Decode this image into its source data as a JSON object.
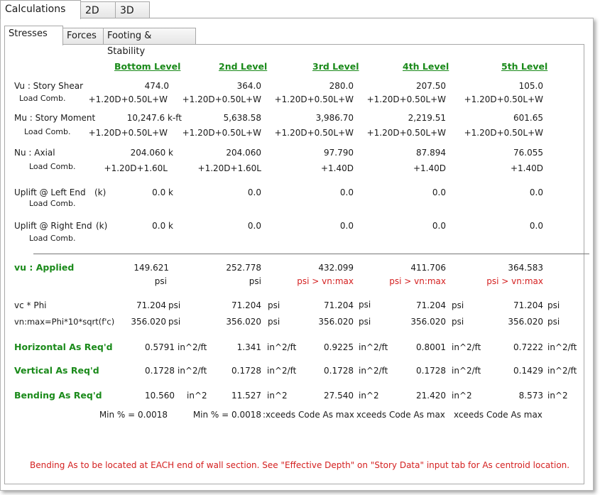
{
  "top_tabs": [
    "Calculations",
    "2D",
    "3D"
  ],
  "sub_tabs": [
    "Stresses",
    "Forces",
    "Footing & Stability"
  ],
  "levels": [
    "Bottom Level",
    "2nd Level",
    "3rd Level",
    "4th Level",
    "5th Level"
  ],
  "labels": {
    "vu_story_shear": "Vu : Story Shear",
    "mu_story_moment": "Mu : Story Moment",
    "nu_axial": "Nu : Axial",
    "uplift_left": "Uplift @ Left End",
    "uplift_right": "Uplift @ Right End",
    "k_unit": "(k)",
    "load_comb": "Load Comb.",
    "vu_applied": "vu : Applied",
    "vc_phi": "vc * Phi",
    "vnmax": "vn:max=Phi*10*sqrt(f'c)",
    "horizontal_as": "Horizontal As Req'd",
    "vertical_as": "Vertical As Req'd",
    "bending_as": "Bending As Req'd"
  },
  "vu_values": [
    "474.0",
    "364.0",
    "280.0",
    "207.50",
    "105.0"
  ],
  "vu_comb": [
    "+1.20D+0.50L+W",
    "+1.20D+0.50L+W",
    "+1.20D+0.50L+W",
    "+1.20D+0.50L+W",
    "+1.20D+0.50L+W"
  ],
  "mu_values": [
    "10,247.6 k-ft",
    "5,638.58",
    "3,986.70",
    "2,219.51",
    "601.65"
  ],
  "mu_comb": [
    "+1.20D+0.50L+W",
    "+1.20D+0.50L+W",
    "+1.20D+0.50L+W",
    "+1.20D+0.50L+W",
    "+1.20D+0.50L+W"
  ],
  "nu_values": [
    "204.060 k",
    "204.060",
    "97.790",
    "87.894",
    "76.055"
  ],
  "nu_comb": [
    "+1.20D+1.60L",
    "+1.20D+1.60L",
    "+1.40D",
    "+1.40D",
    "+1.40D"
  ],
  "uplift_left_values": [
    "0.0 k",
    "0.0",
    "0.0",
    "0.0",
    "0.0"
  ],
  "uplift_right_values": [
    "0.0 k",
    "0.0",
    "0.0",
    "0.0",
    "0.0"
  ],
  "vu_applied_values": [
    "149.621",
    "252.778",
    "432.099",
    "411.706",
    "364.583"
  ],
  "vu_applied_units": [
    "psi",
    "psi",
    "psi > vn:max",
    "psi > vn:max",
    "psi > vn:max"
  ],
  "vc_phi_values": [
    "71.204",
    "71.204",
    "71.204",
    "71.204",
    "71.204"
  ],
  "vnmax_values": [
    "356.020",
    "356.020",
    "356.020",
    "356.020",
    "356.020"
  ],
  "psi": "psi",
  "horizontal_as_values": [
    "0.5791",
    "1.341",
    "0.9225",
    "0.8001",
    "0.7222"
  ],
  "vertical_as_values": [
    "0.1728",
    "0.1728",
    "0.1728",
    "0.1728",
    "0.1429"
  ],
  "as_unit": "in^2/ft",
  "bending_as_values": [
    "10.560",
    "11.527",
    "27.540",
    "21.420",
    "8.573"
  ],
  "bending_unit": "in^2",
  "min_pct": [
    "Min % = 0.0018",
    "Min % = 0.0018",
    ":xceeds Code As max",
    "xceeds Code As max",
    "xceeds Code As max"
  ],
  "footnote": "Bending As to be located at EACH end of wall section. See \"Effective Depth\" on \"Story Data\" input tab for As centroid location.",
  "colors": {
    "green": "#1a8a1a",
    "red": "#d42020"
  }
}
